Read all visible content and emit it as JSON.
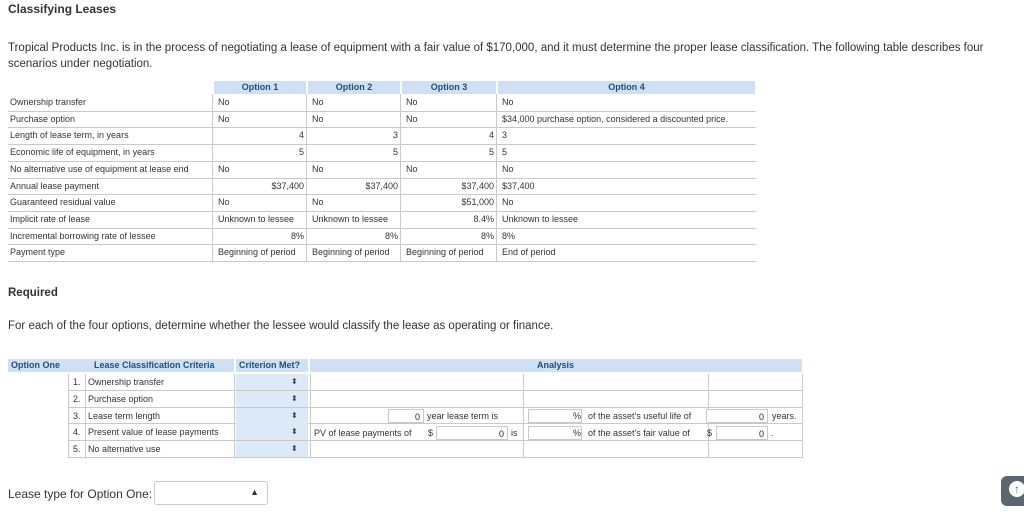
{
  "title": "Classifying Leases",
  "intro": "Tropical Products Inc. is in the process of negotiating a lease of equipment with a fair value of $170,000, and it must determine the proper lease classification. The following table describes four scenarios under negotiation.",
  "scenario_table": {
    "headers": [
      "Option 1",
      "Option 2",
      "Option 3",
      "Option 4"
    ],
    "rows": [
      {
        "label": "Ownership transfer",
        "o1": "No",
        "o2": "No",
        "o3": "No",
        "o4": "No"
      },
      {
        "label": "Purchase option",
        "o1": "No",
        "o2": "No",
        "o3": "No",
        "o4": "$34,000 purchase option, considered a discounted price."
      },
      {
        "label": "Length of lease term, in years",
        "o1": "4",
        "o2": "3",
        "o3": "4",
        "o4": "3"
      },
      {
        "label": "Economic life of equipment, in years",
        "o1": "5",
        "o2": "5",
        "o3": "5",
        "o4": "5"
      },
      {
        "label": "No alternative use of equipment at lease end",
        "o1": "No",
        "o2": "No",
        "o3": "No",
        "o4": "No"
      },
      {
        "label": "Annual lease payment",
        "o1": "$37,400",
        "o2": "$37,400",
        "o3": "$37,400",
        "o4": "$37,400"
      },
      {
        "label": "Guaranteed residual value",
        "o1": "No",
        "o2": "No",
        "o3": "$51,000",
        "o4": "No"
      },
      {
        "label": "Implicit rate of lease",
        "o1": "Unknown to lessee",
        "o2": "Unknown to lessee",
        "o3": "8.4%",
        "o4": "Unknown to lessee"
      },
      {
        "label": "Incremental borrowing rate of lessee",
        "o1": "8%",
        "o2": "8%",
        "o3": "8%",
        "o4": "8%"
      },
      {
        "label": "Payment type",
        "o1": "Beginning of period",
        "o2": "Beginning of period",
        "o3": "Beginning of period",
        "o4": "End of period"
      }
    ]
  },
  "required": "Required",
  "prompt": "For each of the four options, determine whether the lessee would classify the lease as operating or finance.",
  "analysis": {
    "headers": {
      "option": "Option One",
      "criteria": "Lease Classification Criteria",
      "met": "Criterion Met?",
      "analysis": "Analysis"
    },
    "criteria": [
      {
        "num": "1.",
        "label": "Ownership transfer"
      },
      {
        "num": "2.",
        "label": "Purchase option"
      },
      {
        "num": "3.",
        "label": "Lease term length"
      },
      {
        "num": "4.",
        "label": "Present value of lease payments"
      },
      {
        "num": "5.",
        "label": "No alternative use"
      }
    ],
    "row3": {
      "years_value": "0",
      "years_text": "year lease term is",
      "pct_text": "%",
      "useful_life_text": "of the asset's useful life of",
      "life_value": "0",
      "unit": "years."
    },
    "row4": {
      "pv_text": "PV of lease payments of",
      "dollar": "$",
      "pv_value": "0",
      "is_text": "is",
      "pct_text": "%",
      "fair_value_text": "of the asset's fair value of",
      "dollar2": "$",
      "fv_value": "0",
      "end": "."
    }
  },
  "lease_type": {
    "label": "Lease type for Option One:",
    "value": ""
  }
}
